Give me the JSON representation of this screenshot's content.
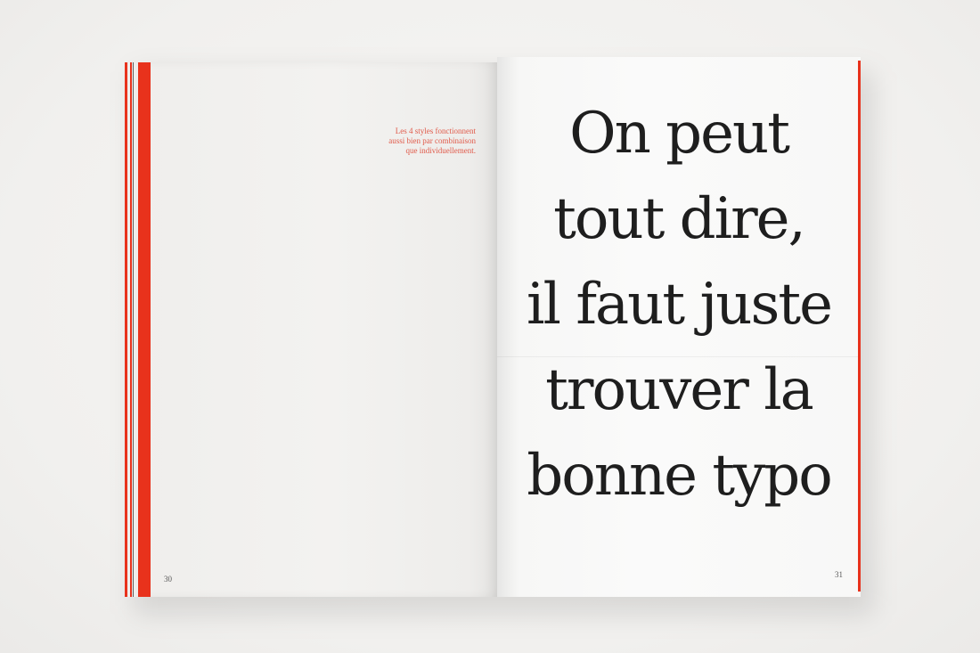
{
  "colors": {
    "accent_red": "#e8321c",
    "caption_red": "#e05a4a",
    "text_dark": "#1e1e1e"
  },
  "left_page": {
    "caption": "Les 4 styles fonctionnent\naussi bien par combinaison\nque individuellement.",
    "page_number": "30"
  },
  "right_page": {
    "headline_lines": [
      "On peut",
      "tout dire,",
      "il faut juste",
      "trouver la",
      "bonne typo"
    ],
    "page_number": "31"
  }
}
